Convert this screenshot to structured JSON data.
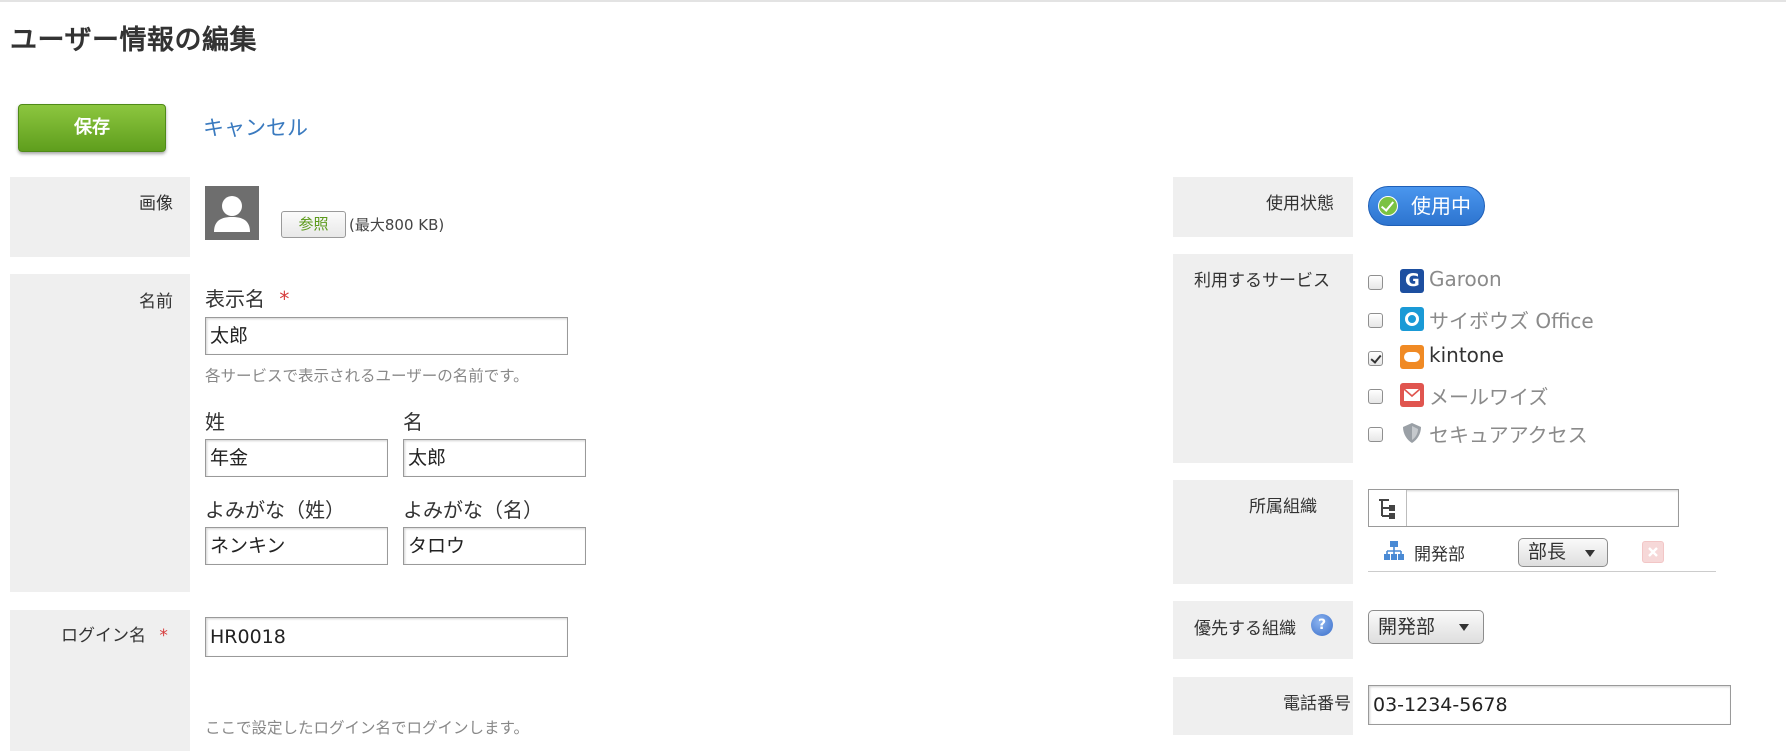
{
  "page": {
    "title": "ユーザー情報の編集"
  },
  "actions": {
    "save_label": "保存",
    "cancel_label": "キャンセル"
  },
  "left": {
    "image": {
      "label": "画像",
      "browse_label": "参照",
      "size_note": "(最大800 KB)"
    },
    "name": {
      "label": "名前",
      "display_name": {
        "label": "表示名",
        "required_mark": "*",
        "value": "太郎",
        "hint": "各サービスで表示されるユーザーの名前です。"
      },
      "last_name": {
        "label": "姓",
        "value": "年金"
      },
      "first_name": {
        "label": "名",
        "value": "太郎"
      },
      "last_reading": {
        "label": "よみがな（姓）",
        "value": "ネンキン"
      },
      "first_reading": {
        "label": "よみがな（名）",
        "value": "タロウ"
      }
    },
    "login": {
      "label": "ログイン名",
      "required_mark": "*",
      "value": "HR0018",
      "hint": "ここで設定したログイン名でログインします。"
    }
  },
  "right": {
    "status": {
      "label": "使用状態",
      "value": "使用中",
      "color": "#2d74cf"
    },
    "services": {
      "label": "利用するサービス",
      "items": [
        {
          "name": "Garoon",
          "checked": false,
          "icon": "garoon-icon",
          "color": "#1d4fa0"
        },
        {
          "name": "サイボウズ Office",
          "checked": false,
          "icon": "cybozu-office-icon",
          "color": "#1a9ad6"
        },
        {
          "name": "kintone",
          "checked": true,
          "icon": "kintone-icon",
          "color": "#f08a24"
        },
        {
          "name": "メールワイズ",
          "checked": false,
          "icon": "mailwise-icon",
          "color": "#e0554f"
        },
        {
          "name": "セキュアアクセス",
          "checked": false,
          "icon": "secure-access-icon",
          "color": "#9aa0a6"
        }
      ]
    },
    "organization": {
      "label": "所属組織",
      "org_name": "開発部",
      "role": "部長"
    },
    "priority_org": {
      "label": "優先する組織",
      "value": "開発部"
    },
    "phone": {
      "label": "電話番号",
      "value": "03-1234-5678"
    }
  }
}
